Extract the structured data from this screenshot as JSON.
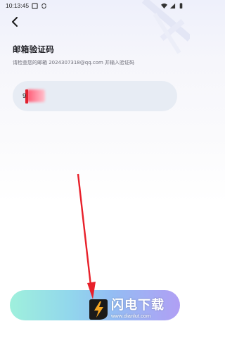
{
  "status_bar": {
    "time": "10:13:45",
    "left_icons": [
      "square-notification-icon",
      "sync-icon"
    ],
    "right_icons": [
      "wifi-icon",
      "signal-icon",
      "battery-icon"
    ]
  },
  "header": {
    "back_icon": "chevron-left-icon",
    "title": "邮箱验证码",
    "subtitle": "请检查您的邮箱 2024307318@qq.com 并输入验证码"
  },
  "code_input": {
    "value": "9"
  },
  "submit_button": {
    "label": ""
  },
  "watermark": {
    "title": "闪电下载",
    "url": "www.dianlut.com"
  },
  "colors": {
    "input_bg": "#e7ecf4",
    "button_gradient_start": "#9ff0dc",
    "button_gradient_end": "#b09ff4",
    "arrow": "#e8202a",
    "logo_orange": "#f5a623"
  }
}
